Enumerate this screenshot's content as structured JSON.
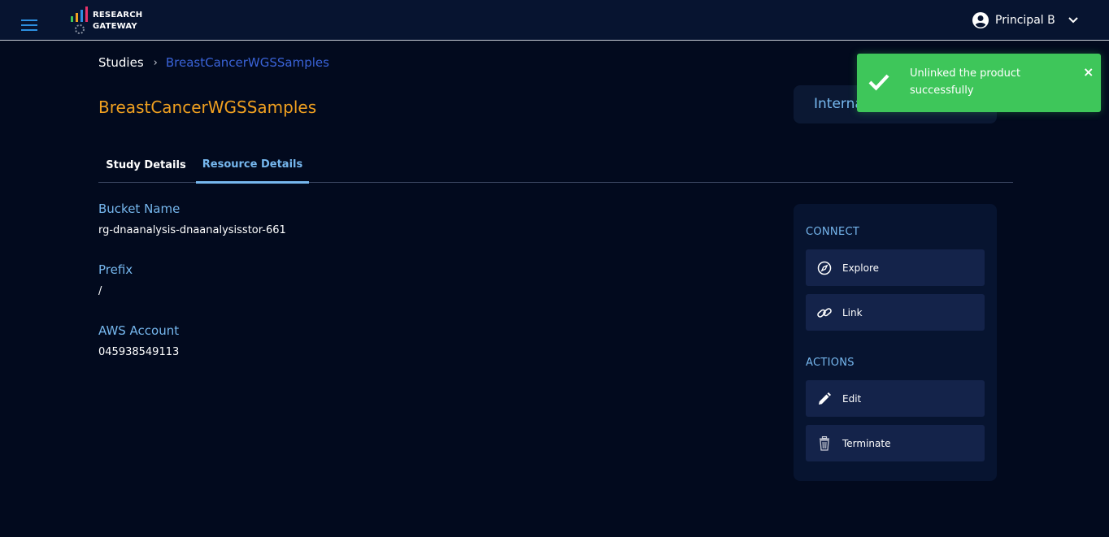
{
  "header": {
    "logo_line1": "RESEARCH",
    "logo_line2": "GATEWAY",
    "user_name": "Principal B"
  },
  "breadcrumb": {
    "root": "Studies",
    "current": "BreastCancerWGSSamples"
  },
  "page_title": "BreastCancerWGSSamples",
  "status_pill": "Interna",
  "tabs": [
    {
      "label": "Study Details",
      "active": false
    },
    {
      "label": "Resource Details",
      "active": true
    }
  ],
  "details": [
    {
      "label": "Bucket Name",
      "value": "rg-dnaanalysis-dnaanalysisstor-661"
    },
    {
      "label": "Prefix",
      "value": "/"
    },
    {
      "label": "AWS Account",
      "value": "045938549113"
    }
  ],
  "panel": {
    "connect_title": "CONNECT",
    "connect_buttons": [
      {
        "label": "Explore",
        "icon": "compass-icon"
      },
      {
        "label": "Link",
        "icon": "link-icon"
      }
    ],
    "actions_title": "ACTIONS",
    "action_buttons": [
      {
        "label": "Edit",
        "icon": "pencil-icon"
      },
      {
        "label": "Terminate",
        "icon": "trash-icon"
      }
    ]
  },
  "toast": {
    "message": "Unlinked the product successfully",
    "close": "×"
  },
  "colors": {
    "background": "#020a1e",
    "accent": "#76b7ee",
    "title": "#f0a020",
    "success": "#3ec65a"
  }
}
